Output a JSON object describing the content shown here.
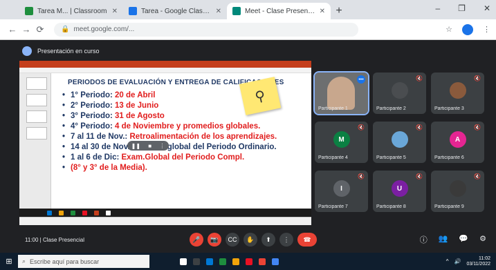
{
  "browser": {
    "tabs": [
      {
        "label": "Tarea M... | Classroom",
        "color": "#1e8e3e",
        "active": false
      },
      {
        "label": "Tarea - Google Classroom",
        "color": "#1a73e8",
        "active": false
      },
      {
        "label": "Meet - Clase Presencial",
        "color": "#00897b",
        "active": true
      }
    ],
    "new_tab": "+",
    "window_controls": [
      "–",
      "❐",
      "✕"
    ],
    "back": "←",
    "forward": "→",
    "reload": "⟳",
    "url": "meet.google.com/...",
    "lock": "🔒",
    "toolbar_icons": [
      "☆",
      "⋮"
    ]
  },
  "meet": {
    "presenter_label": "Presentación en curso",
    "slide": {
      "title": "PERIODOS DE EVALUACIÓN Y ENTREGA DE CALIFICACIONES",
      "items": [
        {
          "lead": "1° Periodo: ",
          "value": "20 de Abril"
        },
        {
          "lead": "2° Periodo: ",
          "value": "13 de Junio"
        },
        {
          "lead": "3° Periodo: ",
          "value": "31 de Agosto"
        },
        {
          "lead": "4° Periodo: ",
          "value": "4 de Noviembre y promedios globales."
        },
        {
          "lead": "7 al 11 de Nov.: ",
          "value": "Retroalimentación de los aprendizajes."
        },
        {
          "lead": "14 al 30 de Nov.: Examen global del Periodo Ordinario.",
          "value": ""
        },
        {
          "lead": "1 al 6 de Dic: ",
          "value": "Exam.Global del Periodo Compl."
        },
        {
          "lead": "",
          "value": "(8° y 3° de la Media)."
        }
      ],
      "sticky_glyph": "⚲",
      "pause_chip": [
        "❚❚",
        "■",
        "⋮"
      ]
    },
    "participants": [
      {
        "name": "Participante 1",
        "initial": "",
        "color": "#c8a78d",
        "speaking": true
      },
      {
        "name": "Participante 2",
        "initial": "",
        "color": "#4a4d50"
      },
      {
        "name": "Participante 3",
        "initial": "",
        "color": "#8a5a3c"
      },
      {
        "name": "Participante 4",
        "initial": "M",
        "color": "#0b8043"
      },
      {
        "name": "Participante 5",
        "initial": "",
        "color": "#6aa7d8"
      },
      {
        "name": "Participante 6",
        "initial": "A",
        "color": "#e52592"
      },
      {
        "name": "Participante 7",
        "initial": "I",
        "color": "#5f6368"
      },
      {
        "name": "Participante 8",
        "initial": "U",
        "color": "#7b1fa2"
      },
      {
        "name": "Participante 9",
        "initial": "",
        "color": "#3a3a3a"
      }
    ],
    "mic_off": "🔇",
    "meeting_info": "11:00 | Clase Presencial",
    "controls": [
      "🎤",
      "📷",
      "CC",
      "✋",
      "⬆",
      "⋮"
    ],
    "leave": "☎",
    "right_controls": [
      "ⓘ",
      "👥",
      "💬",
      "⚙"
    ]
  },
  "taskbar": {
    "start": "⊞",
    "search_placeholder": "Escribe aquí para buscar",
    "search_icon": "⌕",
    "apps": [
      "#ffffff",
      "#3c4043",
      "#0078d4",
      "#1e8e3e",
      "#f0a30a",
      "#e81123",
      "#ea4335",
      "#4285f4"
    ],
    "tray": [
      "^",
      "🔊"
    ],
    "time": "11:02",
    "date": "03/11/2022"
  }
}
